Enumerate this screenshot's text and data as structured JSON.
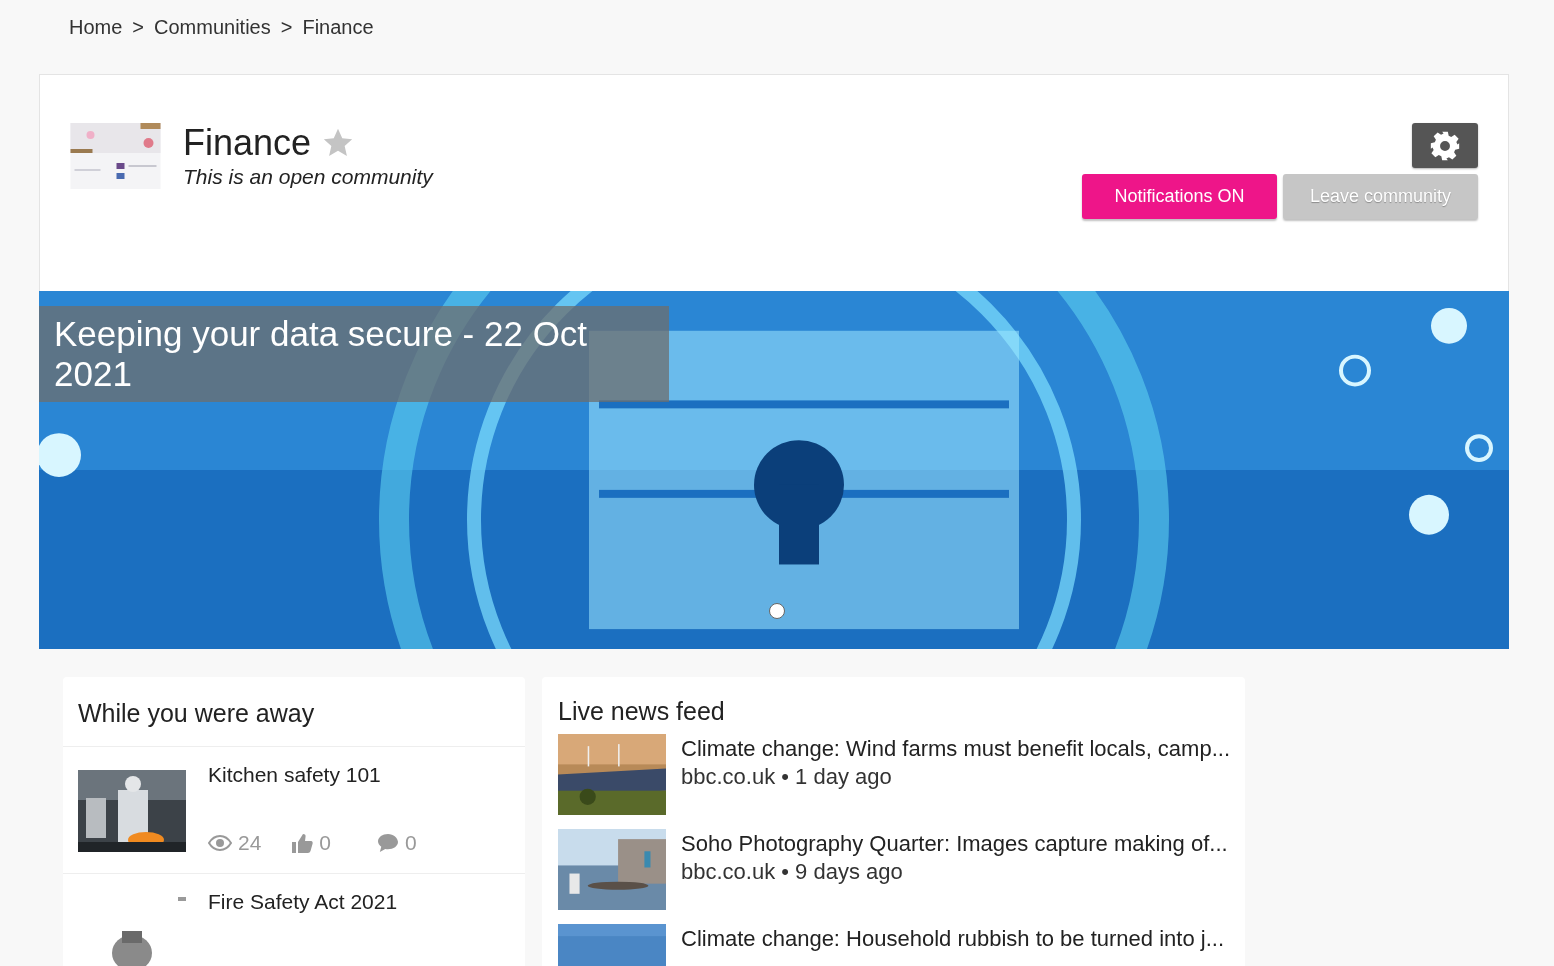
{
  "breadcrumb": [
    {
      "label": "Home",
      "separator": ">"
    },
    {
      "label": "Communities",
      "separator": ">"
    },
    {
      "label": "Finance"
    }
  ],
  "community": {
    "title": "Finance",
    "subtitle": "This is an open community",
    "favorite": false
  },
  "actions": {
    "notifications": "Notifications ON",
    "leave": "Leave community"
  },
  "banner": {
    "caption": "Keeping your data secure - 22 Oct 2021"
  },
  "away": {
    "title": "While you were away",
    "items": [
      {
        "title": "Kitchen safety 101",
        "views": "24",
        "likes": "0",
        "comments": "0"
      },
      {
        "title": "Fire Safety Act 2021"
      }
    ]
  },
  "news": {
    "title": "Live news feed",
    "items": [
      {
        "title": "Climate change: Wind farms must benefit locals, camp...",
        "meta": "bbc.co.uk • 1 day ago"
      },
      {
        "title": "Soho Photography Quarter: Images capture making of...",
        "meta": "bbc.co.uk • 9 days ago"
      },
      {
        "title": "Climate change: Household rubbish to be turned into j..."
      }
    ]
  }
}
